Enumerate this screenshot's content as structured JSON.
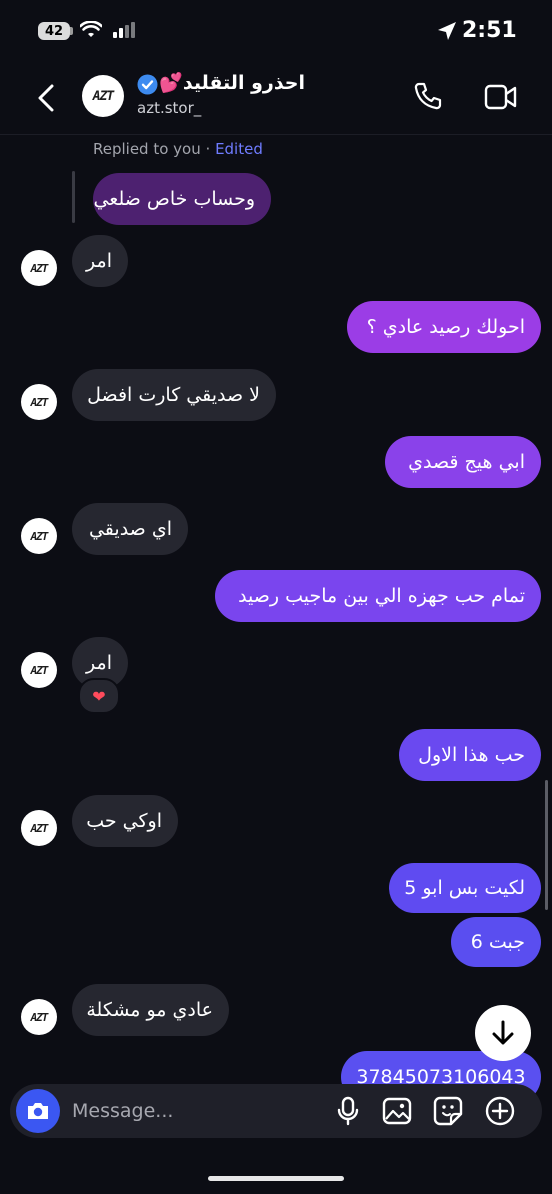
{
  "status": {
    "battery": "42",
    "time": "2:51"
  },
  "header": {
    "title": "احذرو التقليد💕",
    "username": "azt.stor_",
    "logo_text": "AZT"
  },
  "reply": {
    "prefix": "Replied to you",
    "separator": " · ",
    "edited": "Edited",
    "quoted": "وحساب خاص ضلعي"
  },
  "messages": {
    "m1": "امر",
    "m2": "احولك رصيد عادي ؟",
    "m3": "لا صديقي كارت افضل",
    "m4": "ابي هيج قصدي",
    "m5": "اي صديقي",
    "m6": "تمام حب جهزه الي بين ماجيب رصيد",
    "m7": "امر",
    "m7_reaction": "❤",
    "m8": "حب هذا الاول",
    "m9": "اوكي حب",
    "m10": "لكيت بس ابو 5",
    "m11": "جبت 6",
    "m12": "عادي مو مشكلة",
    "m13": "37845073106043"
  },
  "composer": {
    "placeholder": "Message..."
  },
  "colors": {
    "accent": "#3b57f2",
    "out_top": "#9c3ee6",
    "out_bottom": "#5a4ef0",
    "incoming": "#262730"
  }
}
